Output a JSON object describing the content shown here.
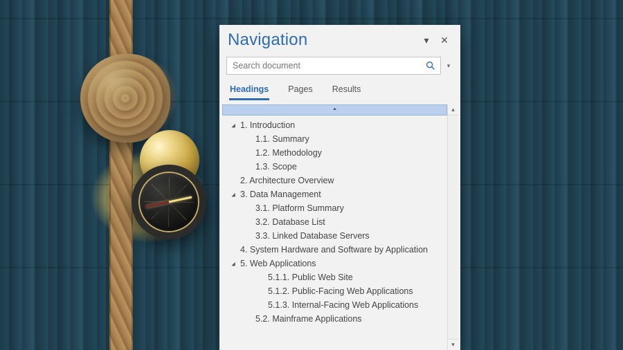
{
  "panel": {
    "title": "Navigation",
    "dropdown_icon": "chevron-down-icon",
    "close_icon": "close-icon"
  },
  "search": {
    "placeholder": "Search document",
    "value": "",
    "icon": "search-icon",
    "caret_icon": "caret-down-icon"
  },
  "tabs": {
    "headings": "Headings",
    "pages": "Pages",
    "results": "Results",
    "active": "headings"
  },
  "outline": [
    {
      "level": 0,
      "expandable": true,
      "expanded": true,
      "label": "1. Introduction"
    },
    {
      "level": 1,
      "expandable": false,
      "expanded": false,
      "label": "1.1. Summary"
    },
    {
      "level": 1,
      "expandable": false,
      "expanded": false,
      "label": "1.2. Methodology"
    },
    {
      "level": 1,
      "expandable": false,
      "expanded": false,
      "label": "1.3. Scope"
    },
    {
      "level": 0,
      "expandable": false,
      "expanded": false,
      "label": "2. Architecture Overview"
    },
    {
      "level": 0,
      "expandable": true,
      "expanded": true,
      "label": "3. Data Management"
    },
    {
      "level": 1,
      "expandable": false,
      "expanded": false,
      "label": "3.1. Platform Summary"
    },
    {
      "level": 1,
      "expandable": false,
      "expanded": false,
      "label": "3.2. Database List"
    },
    {
      "level": 1,
      "expandable": false,
      "expanded": false,
      "label": "3.3. Linked Database Servers"
    },
    {
      "level": 0,
      "expandable": false,
      "expanded": false,
      "label": "4. System Hardware and Software by Application"
    },
    {
      "level": 0,
      "expandable": true,
      "expanded": true,
      "label": "5. Web Applications"
    },
    {
      "level": 2,
      "expandable": false,
      "expanded": false,
      "label": "5.1.1. Public Web Site"
    },
    {
      "level": 2,
      "expandable": false,
      "expanded": false,
      "label": "5.1.2. Public-Facing Web Applications"
    },
    {
      "level": 2,
      "expandable": false,
      "expanded": false,
      "label": "5.1.3. Internal-Facing Web Applications"
    },
    {
      "level": 1,
      "expandable": false,
      "expanded": false,
      "label": "5.2. Mainframe Applications"
    }
  ]
}
